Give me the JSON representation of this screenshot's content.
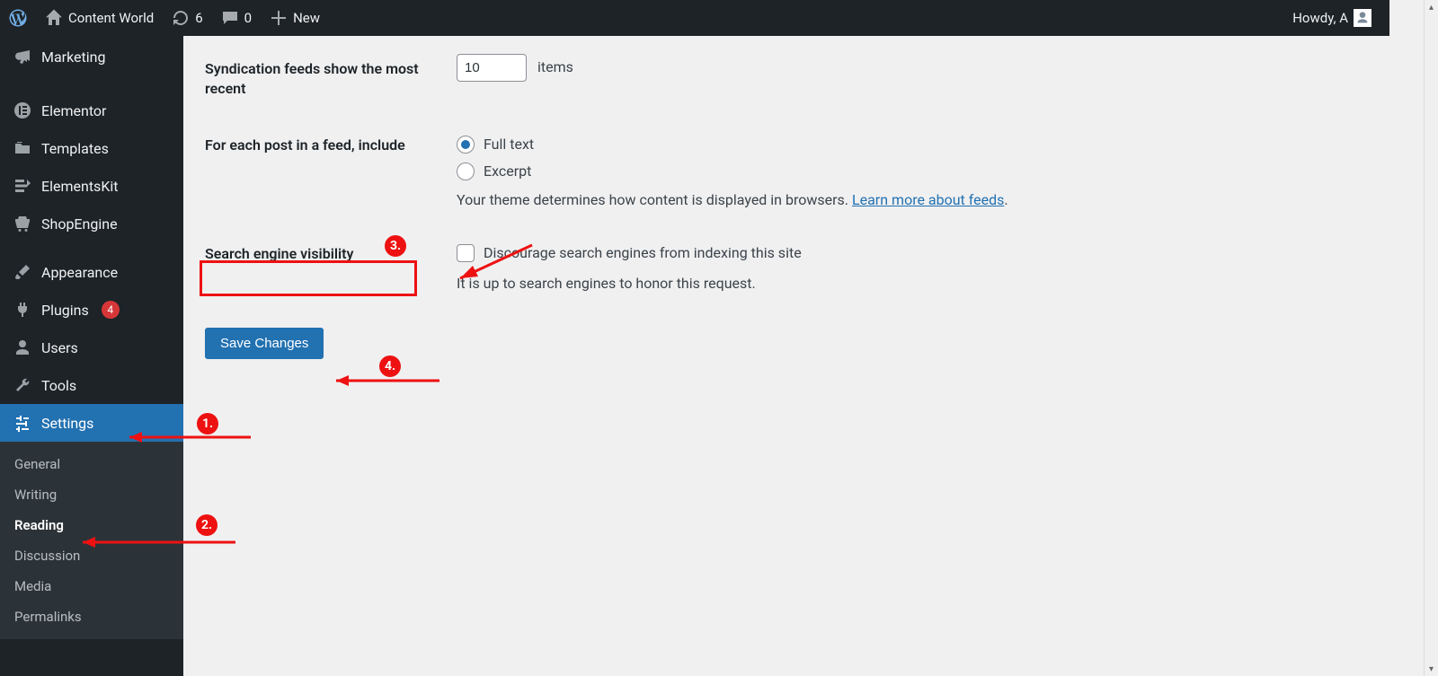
{
  "adminbar": {
    "site_name": "Content World",
    "updates_count": "6",
    "comments_count": "0",
    "new_label": "New",
    "howdy": "Howdy, A"
  },
  "sidebar": {
    "items": [
      {
        "label": "Marketing"
      },
      {
        "label": "Elementor"
      },
      {
        "label": "Templates"
      },
      {
        "label": "ElementsKit"
      },
      {
        "label": "ShopEngine"
      },
      {
        "label": "Appearance"
      },
      {
        "label": "Plugins",
        "badge": "4"
      },
      {
        "label": "Users"
      },
      {
        "label": "Tools"
      },
      {
        "label": "Settings"
      }
    ],
    "submenu": [
      {
        "label": "General"
      },
      {
        "label": "Writing"
      },
      {
        "label": "Reading"
      },
      {
        "label": "Discussion"
      },
      {
        "label": "Media"
      },
      {
        "label": "Permalinks"
      }
    ]
  },
  "settings": {
    "feeds_recent": {
      "label": "Syndication feeds show the most recent",
      "value": "10",
      "unit": "items"
    },
    "feed_include": {
      "label": "For each post in a feed, include",
      "full": "Full text",
      "excerpt": "Excerpt",
      "desc_prefix": "Your theme determines how content is displayed in browsers. ",
      "desc_link": "Learn more about feeds",
      "desc_suffix": "."
    },
    "search_visibility": {
      "label": "Search engine visibility",
      "checkbox": "Discourage search engines from indexing this site",
      "note": "It is up to search engines to honor this request."
    },
    "save_button": "Save Changes"
  },
  "annotations": {
    "n1": "1.",
    "n2": "2.",
    "n3": "3.",
    "n4": "4."
  }
}
